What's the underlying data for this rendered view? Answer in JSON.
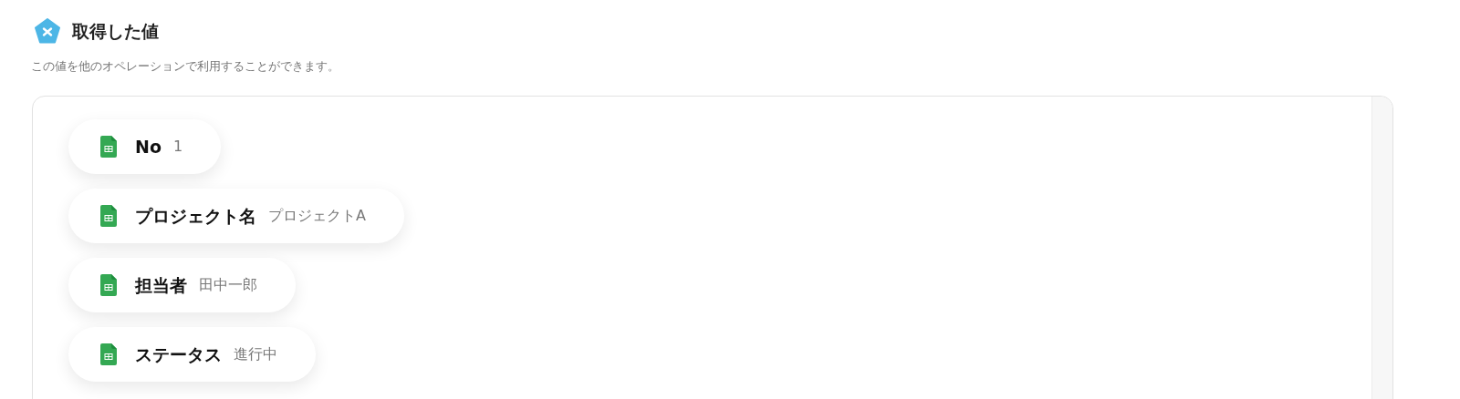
{
  "header": {
    "title": "取得した値",
    "description": "この値を他のオペレーションで利用することができます。"
  },
  "values": [
    {
      "label": "No",
      "value": "1"
    },
    {
      "label": "プロジェクト名",
      "value": "プロジェクトA"
    },
    {
      "label": "担当者",
      "value": "田中一郎"
    },
    {
      "label": "ステータス",
      "value": "進行中"
    }
  ]
}
